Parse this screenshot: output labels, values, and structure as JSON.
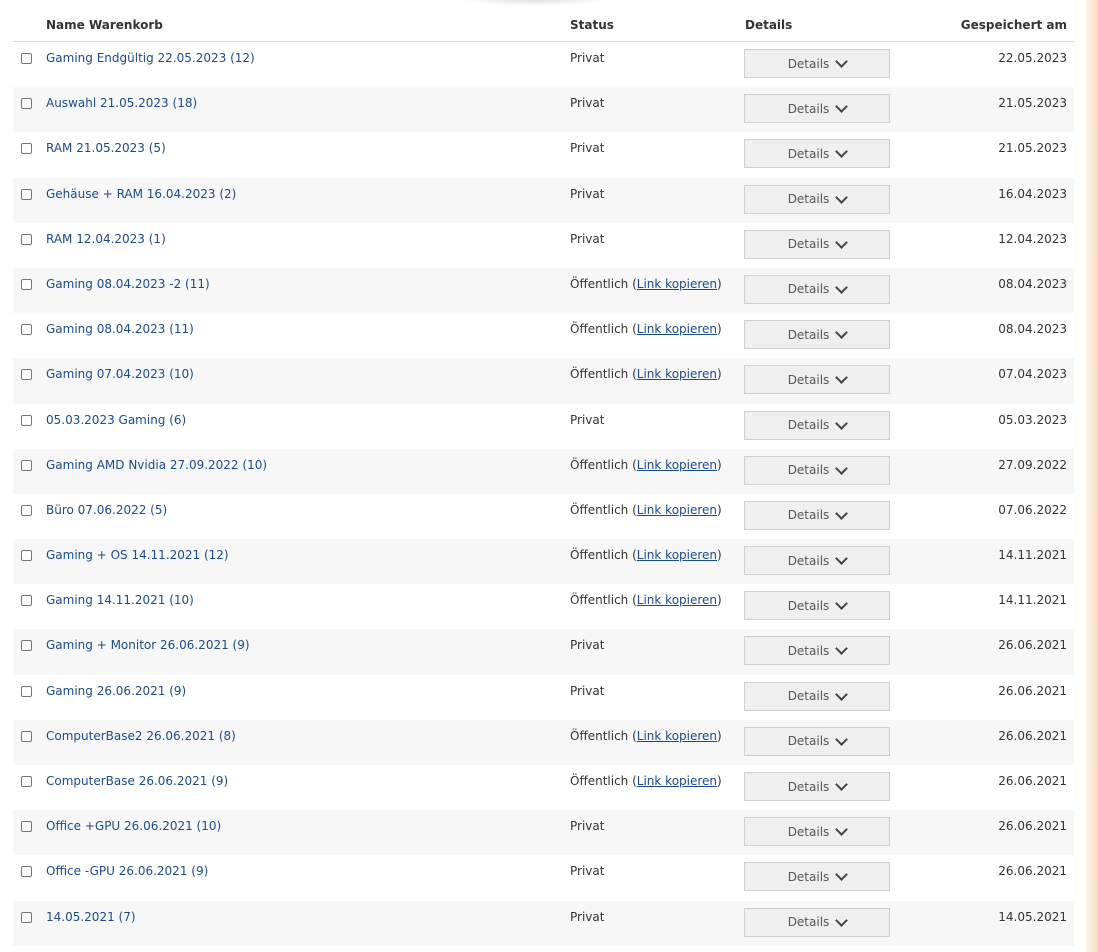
{
  "header": {
    "name": "Name Warenkorb",
    "status": "Status",
    "details": "Details",
    "saved": "Gespeichert am"
  },
  "rows": [
    {
      "name": "Gaming Endgültig 22.05.2023 (12)",
      "status": "Privat",
      "link": "",
      "details": "Details",
      "date": "22.05.2023"
    },
    {
      "name": "Auswahl 21.05.2023 (18)",
      "status": "Privat",
      "link": "",
      "details": "Details",
      "date": "21.05.2023"
    },
    {
      "name": "RAM 21.05.2023 (5)",
      "status": "Privat",
      "link": "",
      "details": "Details",
      "date": "21.05.2023"
    },
    {
      "name": "Gehäuse + RAM 16.04.2023 (2)",
      "status": "Privat",
      "link": "",
      "details": "Details",
      "date": "16.04.2023"
    },
    {
      "name": "RAM 12.04.2023 (1)",
      "status": "Privat",
      "link": "",
      "details": "Details",
      "date": "12.04.2023"
    },
    {
      "name": "Gaming 08.04.2023 -2 (11)",
      "status": "Öffentlich",
      "link": "Link kopieren",
      "details": "Details",
      "date": "08.04.2023"
    },
    {
      "name": "Gaming 08.04.2023 (11)",
      "status": "Öffentlich",
      "link": "Link kopieren",
      "details": "Details",
      "date": "08.04.2023"
    },
    {
      "name": "Gaming 07.04.2023 (10)",
      "status": "Öffentlich",
      "link": "Link kopieren",
      "details": "Details",
      "date": "07.04.2023"
    },
    {
      "name": "05.03.2023 Gaming (6)",
      "status": "Privat",
      "link": "",
      "details": "Details",
      "date": "05.03.2023"
    },
    {
      "name": "Gaming AMD Nvidia 27.09.2022 (10)",
      "status": "Öffentlich",
      "link": "Link kopieren",
      "details": "Details",
      "date": "27.09.2022"
    },
    {
      "name": "Büro 07.06.2022 (5)",
      "status": "Öffentlich",
      "link": "Link kopieren",
      "details": "Details",
      "date": "07.06.2022"
    },
    {
      "name": "Gaming + OS 14.11.2021 (12)",
      "status": "Öffentlich",
      "link": "Link kopieren",
      "details": "Details",
      "date": "14.11.2021"
    },
    {
      "name": "Gaming 14.11.2021 (10)",
      "status": "Öffentlich",
      "link": "Link kopieren",
      "details": "Details",
      "date": "14.11.2021"
    },
    {
      "name": "Gaming + Monitor 26.06.2021 (9)",
      "status": "Privat",
      "link": "",
      "details": "Details",
      "date": "26.06.2021"
    },
    {
      "name": "Gaming 26.06.2021 (9)",
      "status": "Privat",
      "link": "",
      "details": "Details",
      "date": "26.06.2021"
    },
    {
      "name": "ComputerBase2 26.06.2021 (8)",
      "status": "Öffentlich",
      "link": "Link kopieren",
      "details": "Details",
      "date": "26.06.2021"
    },
    {
      "name": "ComputerBase 26.06.2021 (9)",
      "status": "Öffentlich",
      "link": "Link kopieren",
      "details": "Details",
      "date": "26.06.2021"
    },
    {
      "name": "Office +GPU 26.06.2021 (10)",
      "status": "Privat",
      "link": "",
      "details": "Details",
      "date": "26.06.2021"
    },
    {
      "name": "Office -GPU 26.06.2021 (9)",
      "status": "Privat",
      "link": "",
      "details": "Details",
      "date": "26.06.2021"
    },
    {
      "name": "14.05.2021 (7)",
      "status": "Privat",
      "link": "",
      "details": "Details",
      "date": "14.05.2021"
    }
  ],
  "icons": {
    "details_chevron": "chevron-down-icon"
  },
  "colors": {
    "link": "#1a4b8c",
    "row_alt": "#f7f7f7",
    "button_bg": "#efefef"
  }
}
